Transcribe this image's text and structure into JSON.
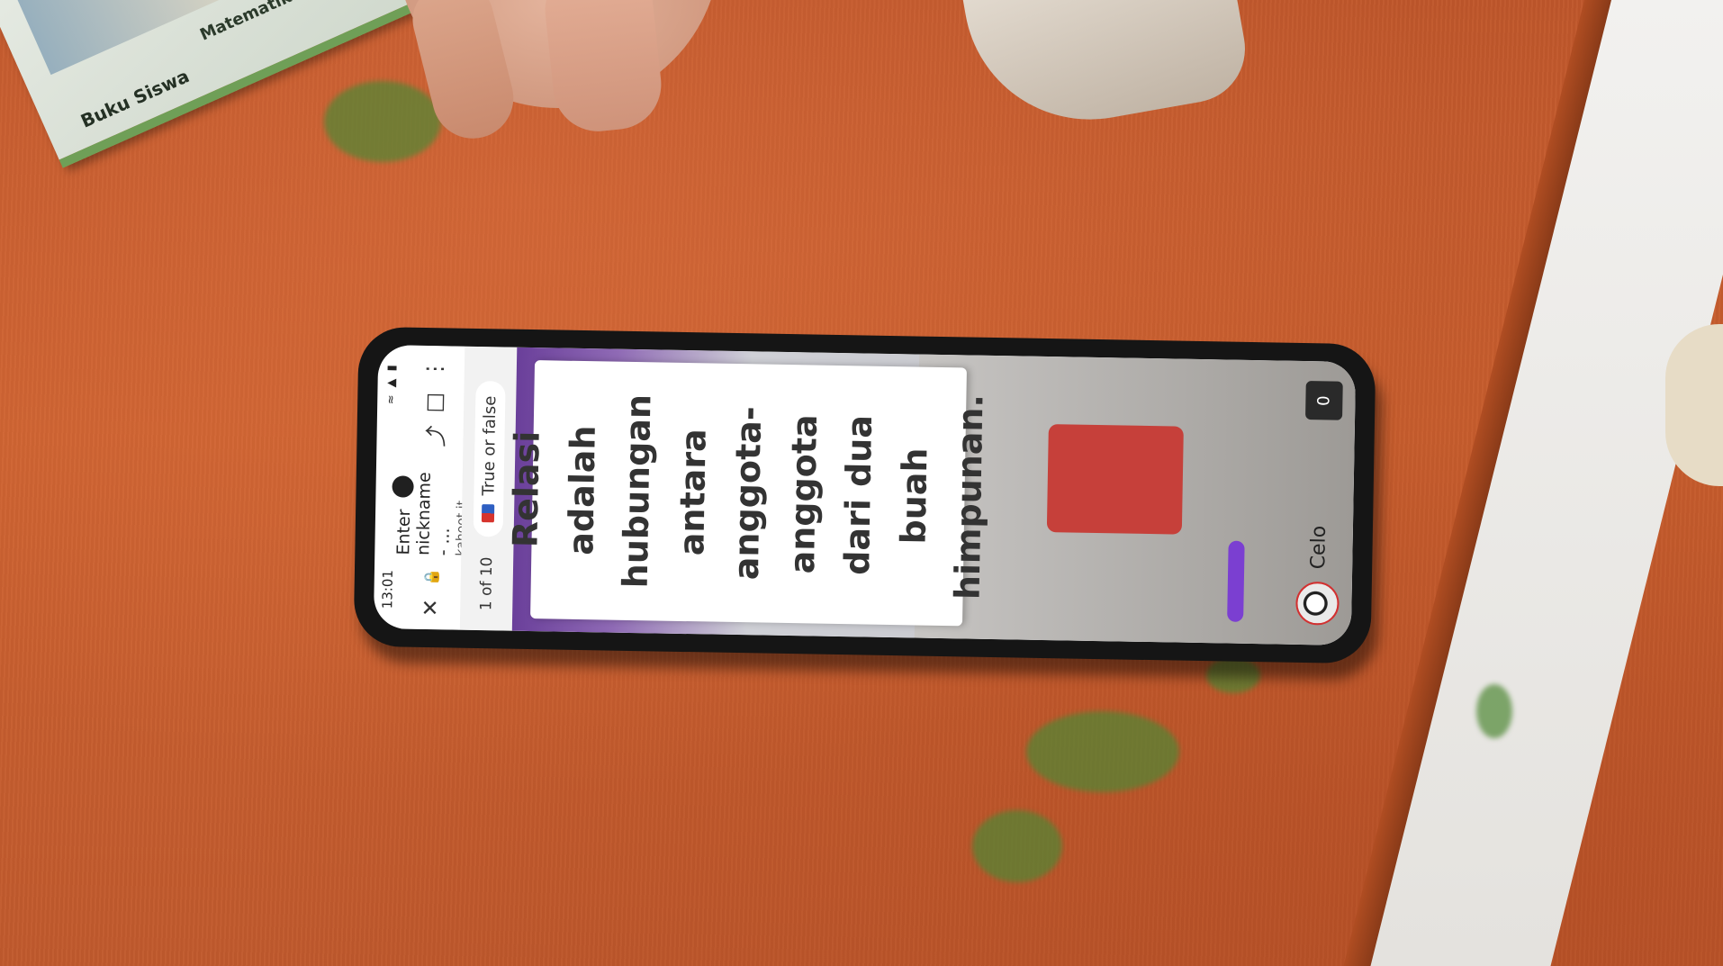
{
  "book": {
    "series_label": "Matematika",
    "title_label": "Buku Siswa"
  },
  "phone": {
    "status": {
      "time": "13:01"
    },
    "browser": {
      "tab_title": "Enter nickname - ...",
      "domain": "kahoot.it"
    },
    "quiz": {
      "progress": "1 of 10",
      "question_type": "True or false",
      "question": "Relasi adalah hubungan antara anggota-anggota dari dua buah himpunan.",
      "player_name": "Celo",
      "score": "0"
    },
    "icons": {
      "close": "close-icon",
      "lock": "lock-icon",
      "share": "share-icon",
      "bookmark": "bookmark-icon",
      "menu": "more-vertical-icon"
    }
  },
  "colors": {
    "table": "#c65a2c",
    "kahoot_purple": "#6a3f9a",
    "answer_bar": "#7b3fd1",
    "phone_body": "#151515"
  }
}
